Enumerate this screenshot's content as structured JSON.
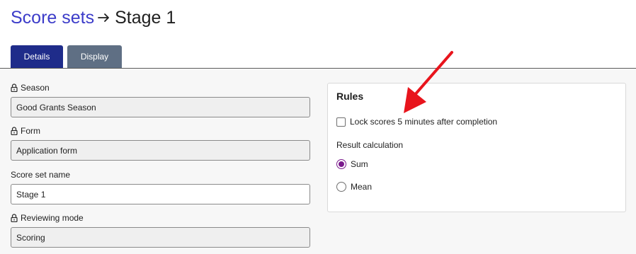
{
  "breadcrumb": {
    "parent_label": "Score sets",
    "current_label": "Stage 1"
  },
  "tabs": [
    {
      "label": "Details",
      "active": true
    },
    {
      "label": "Display",
      "active": false
    }
  ],
  "form": {
    "season": {
      "label": "Season",
      "value": "Good Grants Season",
      "locked": true
    },
    "form": {
      "label": "Form",
      "value": "Application form",
      "locked": true
    },
    "score_set_name": {
      "label": "Score set name",
      "value": "Stage 1",
      "locked": false
    },
    "reviewing_mode": {
      "label": "Reviewing mode",
      "value": "Scoring",
      "locked": true
    }
  },
  "rules": {
    "title": "Rules",
    "lock_scores": {
      "label": "Lock scores 5 minutes after completion",
      "checked": false
    },
    "result_calculation": {
      "label": "Result calculation",
      "options": [
        {
          "label": "Sum",
          "selected": true
        },
        {
          "label": "Mean",
          "selected": false
        }
      ]
    }
  },
  "colors": {
    "breadcrumb_link": "#3c3cc9",
    "tab_active": "#1f2c8a",
    "tab_inactive": "#5f6f84",
    "radio_accent": "#7a1a8c",
    "annotation_arrow": "#e8141c"
  },
  "icons": {
    "breadcrumb_separator": "arrow-right-icon",
    "locked_field": "lock-icon",
    "annotation": "red-arrow-icon"
  }
}
